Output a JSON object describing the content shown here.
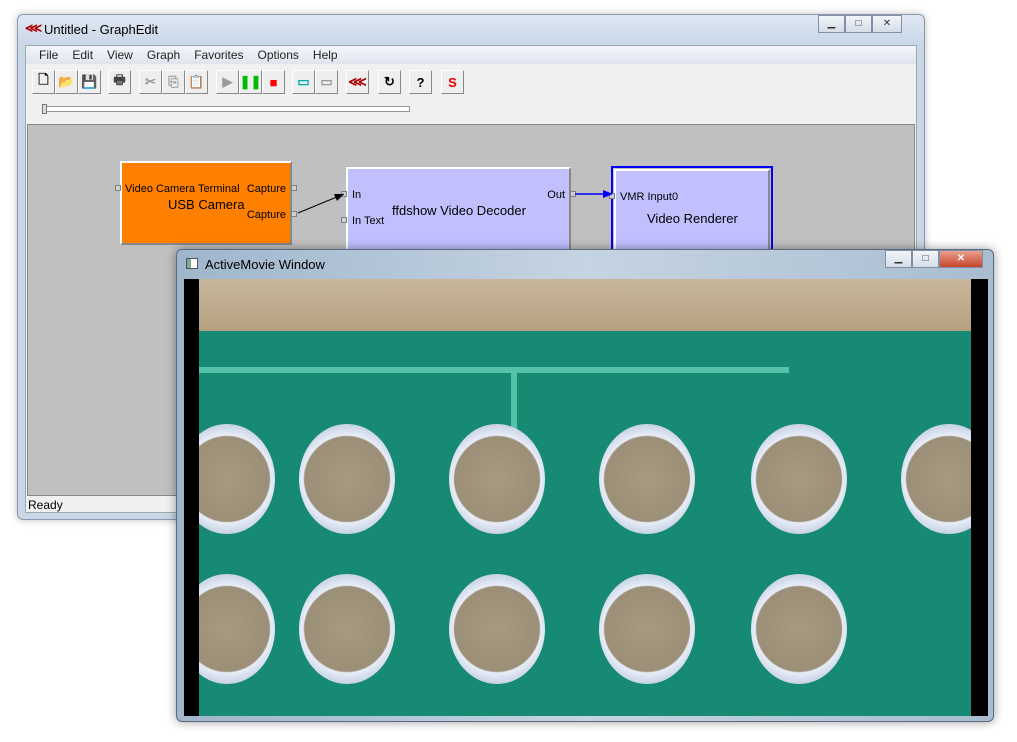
{
  "graphedit": {
    "title": "Untitled - GraphEdit",
    "menu": [
      "File",
      "Edit",
      "View",
      "Graph",
      "Favorites",
      "Options",
      "Help"
    ],
    "toolbar": [
      {
        "name": "new-icon",
        "glyph": "🗋",
        "color": "#000"
      },
      {
        "name": "open-icon",
        "glyph": "📂",
        "color": "#c90"
      },
      {
        "name": "save-icon",
        "glyph": "💾",
        "color": "#880"
      },
      {
        "name": "print-icon",
        "glyph": "🖶",
        "color": "#444"
      },
      {
        "name": "cut-icon",
        "glyph": "✂",
        "color": "#999"
      },
      {
        "name": "copy-icon",
        "glyph": "⎘",
        "color": "#999"
      },
      {
        "name": "paste-icon",
        "glyph": "📋",
        "color": "#999"
      },
      {
        "name": "play-icon",
        "glyph": "▶",
        "color": "#999"
      },
      {
        "name": "pause-icon",
        "glyph": "❚❚",
        "color": "#0b0"
      },
      {
        "name": "stop-icon",
        "glyph": "■",
        "color": "#f00"
      },
      {
        "name": "seek-icon",
        "glyph": "▭",
        "color": "#0aa"
      },
      {
        "name": "frame-step-icon",
        "glyph": "▭",
        "color": "#999"
      },
      {
        "name": "graphedit-logo-icon",
        "glyph": "⋘",
        "color": "#a00"
      },
      {
        "name": "refresh-icon",
        "glyph": "↻",
        "color": "#000"
      },
      {
        "name": "help-icon",
        "glyph": "?",
        "color": "#000"
      },
      {
        "name": "sync-icon",
        "glyph": "S",
        "color": "#e00"
      }
    ],
    "filters": {
      "usb_camera": {
        "name": "USB Camera",
        "pins_in": [
          "Video Camera Terminal"
        ],
        "pins_out": [
          "Capture",
          "Capture"
        ],
        "color": "#ff8000"
      },
      "decoder": {
        "name": "ffdshow Video Decoder",
        "pins_in": [
          "In",
          "In Text"
        ],
        "pins_out": [
          "Out"
        ],
        "color": "#c0c0ff"
      },
      "renderer": {
        "name": "Video Renderer",
        "pins_in": [
          "VMR Input0"
        ],
        "color": "#c0c0ff"
      }
    },
    "status": "Ready"
  },
  "activemovie": {
    "title": "ActiveMovie Window"
  }
}
